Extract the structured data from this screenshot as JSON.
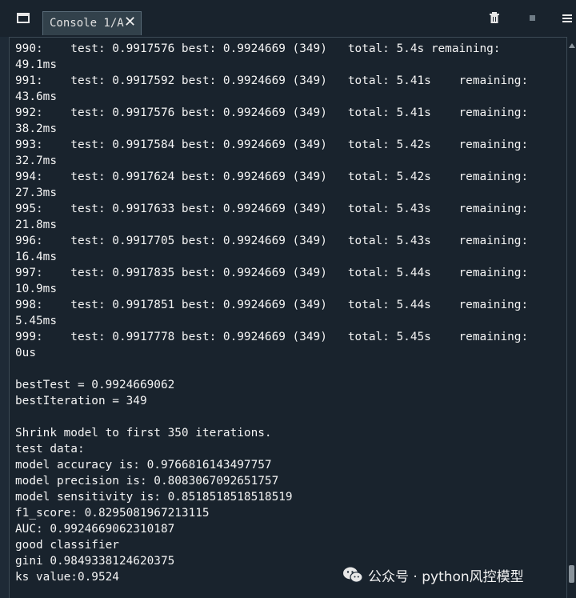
{
  "tab": {
    "label": "Console 1/A",
    "close_glyph": "✕"
  },
  "toolbar": {
    "icons": [
      "window-icon",
      "trash-icon",
      "stop-icon",
      "menu-icon"
    ]
  },
  "console_lines": [
    "990:    test: 0.9917576 best: 0.9924669 (349)   total: 5.4s remaining:",
    "49.1ms",
    "991:    test: 0.9917592 best: 0.9924669 (349)   total: 5.41s    remaining:",
    "43.6ms",
    "992:    test: 0.9917576 best: 0.9924669 (349)   total: 5.41s    remaining:",
    "38.2ms",
    "993:    test: 0.9917584 best: 0.9924669 (349)   total: 5.42s    remaining:",
    "32.7ms",
    "994:    test: 0.9917624 best: 0.9924669 (349)   total: 5.42s    remaining:",
    "27.3ms",
    "995:    test: 0.9917633 best: 0.9924669 (349)   total: 5.43s    remaining:",
    "21.8ms",
    "996:    test: 0.9917705 best: 0.9924669 (349)   total: 5.43s    remaining:",
    "16.4ms",
    "997:    test: 0.9917835 best: 0.9924669 (349)   total: 5.44s    remaining:",
    "10.9ms",
    "998:    test: 0.9917851 best: 0.9924669 (349)   total: 5.44s    remaining:",
    "5.45ms",
    "999:    test: 0.9917778 best: 0.9924669 (349)   total: 5.45s    remaining:",
    "0us",
    "",
    "bestTest = 0.9924669062",
    "bestIteration = 349",
    "",
    "Shrink model to first 350 iterations.",
    "test data:",
    "model accuracy is: 0.9766816143497757",
    "model precision is: 0.8083067092651757",
    "model sensitivity is: 0.8518518518518519",
    "f1_score: 0.8295081967213115",
    "AUC: 0.9924669062310187",
    "good classifier",
    "gini 0.9849338124620375",
    "ks value:0.9524"
  ],
  "watermark": {
    "text": "公众号 · python风控模型",
    "icon": "wechat-icon"
  },
  "colors": {
    "background": "#19232d",
    "text": "#f4f4f4",
    "tab": "#32414b",
    "border": "#3c4a55"
  }
}
